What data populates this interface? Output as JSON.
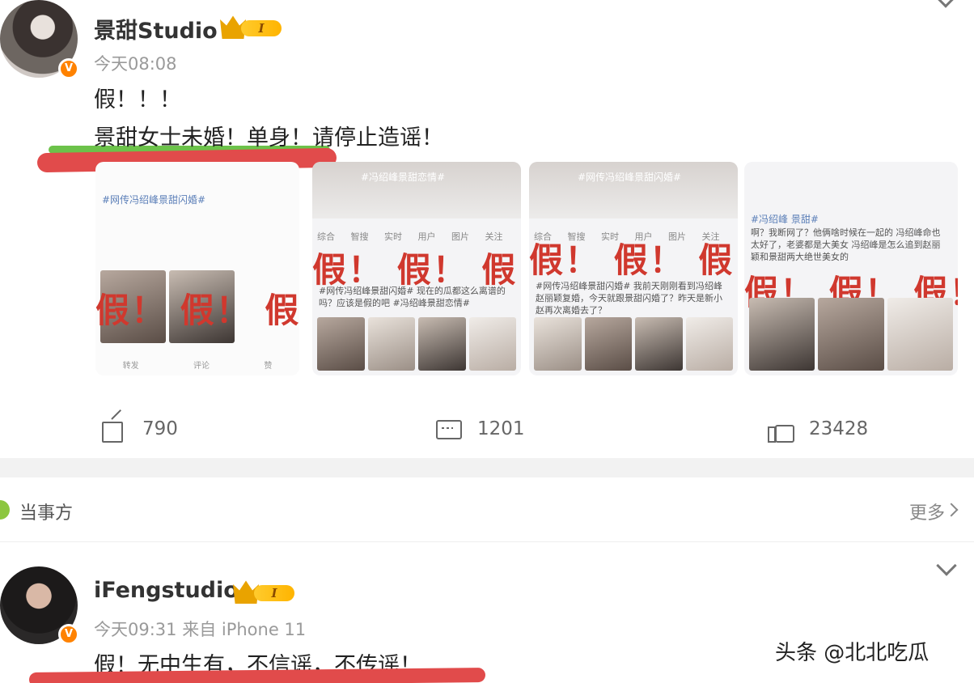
{
  "post1": {
    "username": "景甜Studio",
    "vip_level": "I",
    "timestamp": "今天08:08",
    "line1": "假！！！",
    "line2": "景甜女士未婚！单身！请停止造谣！",
    "images": [
      {
        "tag": "#网传冯绍峰景甜闪婚#",
        "stamp": "假！ 假！ 假！",
        "actions": [
          "转发",
          "评论",
          "赞"
        ]
      },
      {
        "tag": "#冯绍峰景甜恋情#",
        "tabs": "综合 智搜 实时 用户 图片 关注",
        "stamp": "假！ 假！ 假！",
        "caption": "#网传冯绍峰景甜闪婚# 现在的瓜都这么离谱的吗？应该是假的吧 #冯绍峰景甜恋情#"
      },
      {
        "tag": "#网传冯绍峰景甜闪婚#",
        "tabs": "综合 智搜 实时 用户 图片 关注",
        "stamp": "假！ 假！ 假！",
        "caption": "#网传冯绍峰景甜闪婚# 我前天刚刚看到冯绍峰赵丽颖复婚，今天就跟景甜闪婚了？昨天是新小赵再次离婚去了？"
      },
      {
        "tag": "#冯绍峰 景甜#",
        "stamp": "假！ 假！ 假！",
        "caption": "啊？我断网了？他俩啥时候在一起的 冯绍峰命也太好了，老婆都是大美女 冯绍峰是怎么追到赵丽颖和景甜两大绝世美女的"
      }
    ],
    "repost_count": "790",
    "comment_count": "1201",
    "like_count": "23428"
  },
  "section": {
    "label": "当事方",
    "more": "更多"
  },
  "post2": {
    "username": "iFengstudio",
    "vip_level": "I",
    "timestamp": "今天09:31  来自 iPhone 11",
    "line1": "假！无中生有，不信谣，不传谣！"
  },
  "watermark": "头条 @北北吃瓜",
  "colors": {
    "accent_orange": "#ff8200",
    "stamp_red": "#d0382e",
    "underline_red": "#e14b4b",
    "underline_green": "#6cc24a"
  }
}
